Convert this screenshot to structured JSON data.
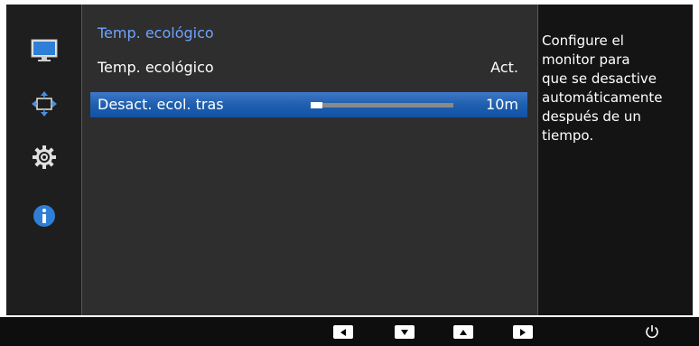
{
  "menu": {
    "title": "Temp. ecológico",
    "rows": [
      {
        "label": "Temp. ecológico",
        "value": "Act."
      },
      {
        "label": "Desact. ecol. tras",
        "value": "10m",
        "slider_level_percent": 8
      }
    ]
  },
  "description": {
    "lines": [
      "Configure el",
      "monitor para",
      "que se desactive",
      "automáticamente",
      "después de un",
      "tiempo."
    ]
  },
  "sidebar": {
    "icons": [
      "monitor-icon",
      "position-arrows-icon",
      "gear-icon",
      "info-icon"
    ]
  },
  "controls": {
    "buttons": [
      "left-arrow-icon",
      "down-arrow-icon",
      "up-arrow-icon",
      "right-arrow-icon",
      "power-icon"
    ]
  },
  "colors": {
    "accent_blue": "#1f5fae",
    "title_blue": "#6fa3ff",
    "panel_bg": "#2e2e2e"
  }
}
